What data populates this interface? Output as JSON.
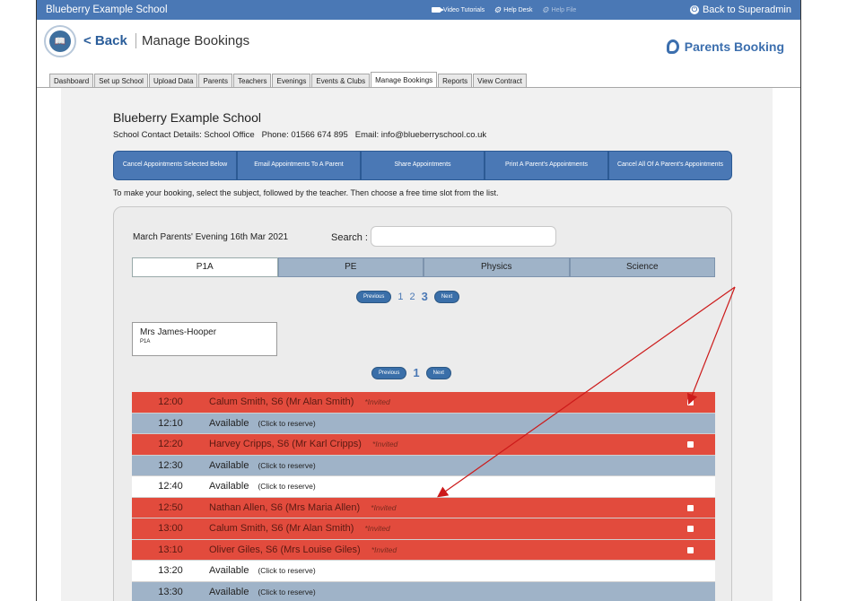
{
  "topbar": {
    "school": "Blueberry Example School",
    "video_tutorials": "Video Tutorials",
    "help_desk": "Help Desk",
    "help_file": "Help File",
    "back_to_superadmin": "Back to Superadmin"
  },
  "header": {
    "back": "< Back",
    "title": "Manage Bookings",
    "brand": "Parents Booking"
  },
  "tabs": [
    "Dashboard",
    "Set up School",
    "Upload Data",
    "Parents",
    "Teachers",
    "Evenings",
    "Events & Clubs",
    "Manage Bookings",
    "Reports",
    "View Contract"
  ],
  "active_tab": "Manage Bookings",
  "school": {
    "name": "Blueberry Example School",
    "contact_label": "School Contact Details:",
    "contact_office": "School Office",
    "phone_label": "Phone:",
    "phone": "01566 674 895",
    "email_label": "Email:",
    "email": "info@blueberryschool.co.uk"
  },
  "actions": [
    "Cancel Appointments Selected Below",
    "Email Appointments To A Parent",
    "Share Appointments",
    "Print A Parent's Appointments",
    "Cancel All Of A Parent's Appointments"
  ],
  "instructions": "To make your booking, select the subject, followed by the teacher. Then choose a free time slot from the list.",
  "panel": {
    "evening": "March Parents' Evening 16th Mar 2021",
    "search_label": "Search :",
    "search_value": "",
    "subjects": [
      "P1A",
      "PE",
      "Physics",
      "Science"
    ],
    "active_subject": "P1A",
    "subject_pager": {
      "previous": "Previous",
      "pages": [
        "1",
        "2",
        "3"
      ],
      "current": "3",
      "next": "Next"
    },
    "teacher": {
      "name": "Mrs James-Hooper",
      "class": "P1A"
    },
    "teacher_pager": {
      "previous": "Previous",
      "pages": [
        "1"
      ],
      "current": "1",
      "next": "Next"
    },
    "slots": [
      {
        "time": "12:00",
        "who": "Calum Smith, S6 (Mr Alan Smith)",
        "note": "*Invited",
        "status": "invited",
        "checkbox": true
      },
      {
        "time": "12:10",
        "who": "Available",
        "note": "(Click to reserve)",
        "status": "available",
        "checkbox": false
      },
      {
        "time": "12:20",
        "who": "Harvey Cripps, S6 (Mr Karl Cripps)",
        "note": "*Invited",
        "status": "invited",
        "checkbox": true
      },
      {
        "time": "12:30",
        "who": "Available",
        "note": "(Click to reserve)",
        "status": "available",
        "checkbox": false
      },
      {
        "time": "12:40",
        "who": "Available",
        "note": "(Click to reserve)",
        "status": "available-white",
        "checkbox": false
      },
      {
        "time": "12:50",
        "who": "Nathan Allen, S6 (Mrs Maria Allen)",
        "note": "*Invited",
        "status": "invited",
        "checkbox": true
      },
      {
        "time": "13:00",
        "who": "Calum Smith, S6 (Mr Alan Smith)",
        "note": "*Invited",
        "status": "invited",
        "checkbox": true
      },
      {
        "time": "13:10",
        "who": "Oliver Giles, S6 (Mrs Louise Giles)",
        "note": "*Invited",
        "status": "invited",
        "checkbox": true
      },
      {
        "time": "13:20",
        "who": "Available",
        "note": "(Click to reserve)",
        "status": "available-white",
        "checkbox": false
      },
      {
        "time": "13:30",
        "who": "Available",
        "note": "(Click to reserve)",
        "status": "available",
        "checkbox": false
      }
    ]
  },
  "colors": {
    "topbar": "#4a78b5",
    "invited": "#e24b3d",
    "available": "#9fb3c8",
    "annotation_arrow": "#cc1a1a"
  },
  "icons": [
    "video-camera-icon",
    "help-desk-icon",
    "help-file-icon",
    "power-icon",
    "school-logo-icon",
    "parents-booking-logo-icon",
    "checkbox-icon"
  ]
}
